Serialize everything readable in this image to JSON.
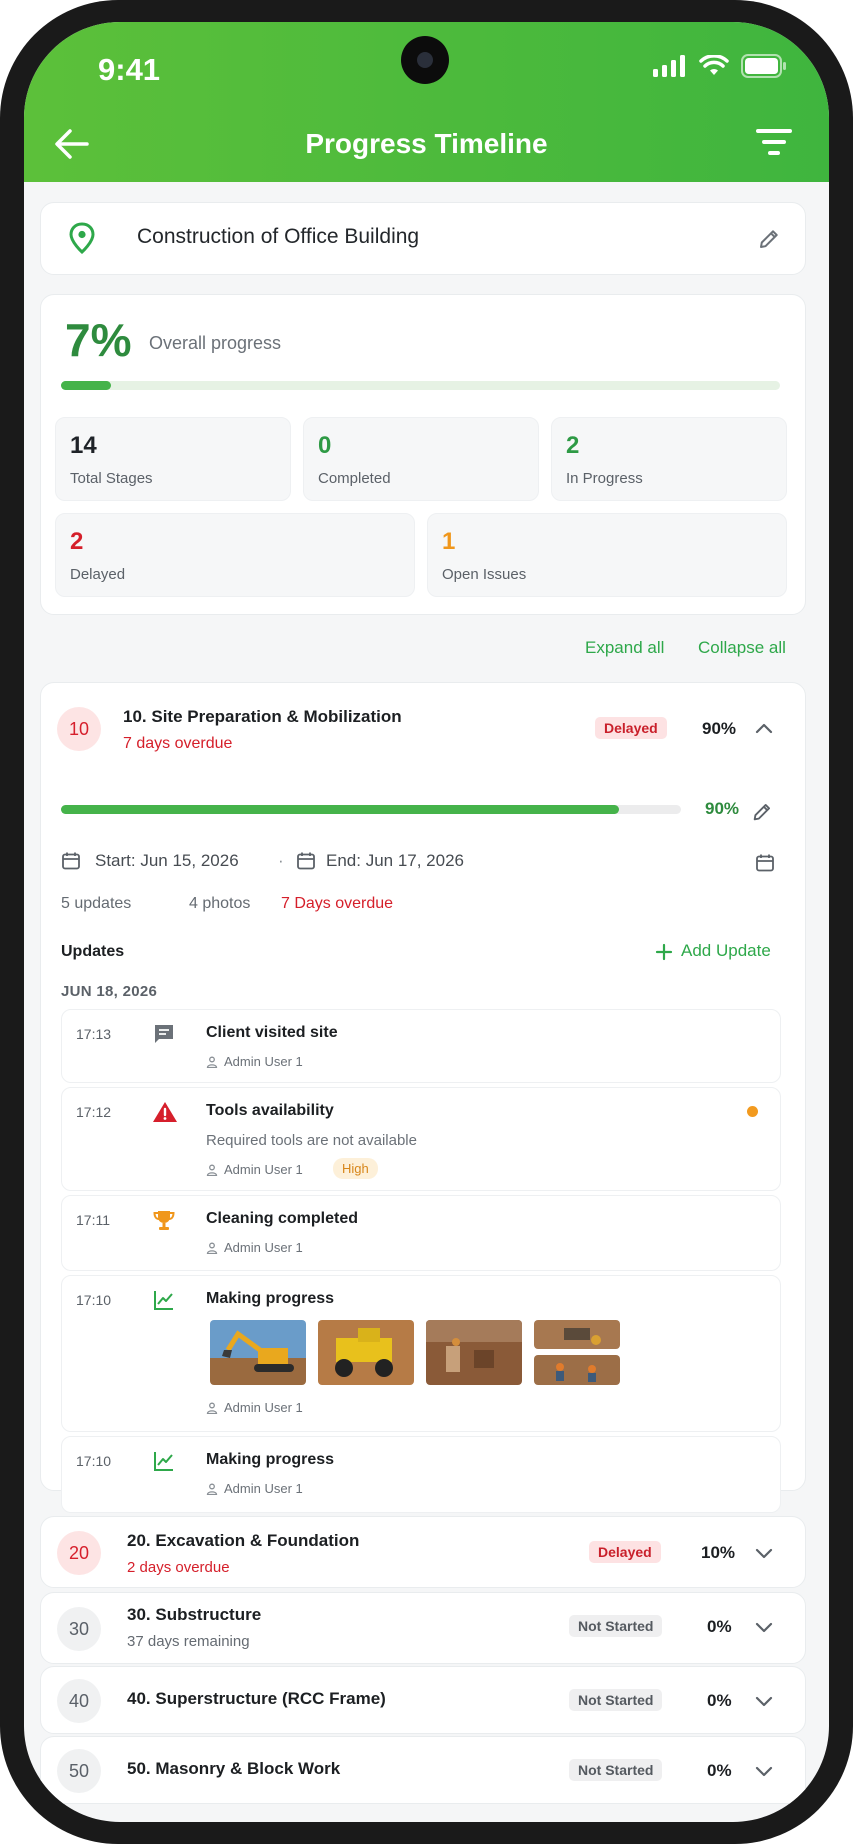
{
  "status_bar": {
    "time": "9:41"
  },
  "header": {
    "title": "Progress Timeline"
  },
  "project": {
    "name": "Construction of Office Building"
  },
  "overall": {
    "percent_label": "7%",
    "percent": 7,
    "label": "Overall progress",
    "stats": [
      {
        "value": "14",
        "label": "Total Stages",
        "color": "#2b2f33"
      },
      {
        "value": "0",
        "label": "Completed",
        "color": "#2e9a45"
      },
      {
        "value": "2",
        "label": "In Progress",
        "color": "#2e9a45"
      },
      {
        "value": "2",
        "label": "Delayed",
        "color": "#d51f2a"
      },
      {
        "value": "1",
        "label": "Open Issues",
        "color": "#f0971c"
      }
    ]
  },
  "actions": {
    "expand_all": "Expand all",
    "collapse_all": "Collapse all"
  },
  "expanded_stage": {
    "number": "10",
    "title": "10. Site Preparation & Mobilization",
    "subtitle": "7 days overdue",
    "status": "Delayed",
    "percent_label": "90%",
    "percent": 90,
    "start": "Start: Jun 15, 2026",
    "separator": "·",
    "end": "End: Jun 17, 2026",
    "updates_count": "5 updates",
    "photos_count": "4 photos",
    "overdue": "7 Days overdue",
    "updates_heading": "Updates",
    "add_update": "Add Update",
    "day": "JUN 18, 2026",
    "updates": [
      {
        "time": "17:13",
        "title": "Client visited site",
        "user": "Admin User 1",
        "icon": "comment-icon"
      },
      {
        "time": "17:12",
        "title": "Tools availability",
        "description": "Required tools are not available",
        "user": "Admin User 1",
        "priority": "High",
        "icon": "warning-icon"
      },
      {
        "time": "17:11",
        "title": "Cleaning completed",
        "user": "Admin User 1",
        "icon": "trophy-icon"
      },
      {
        "time": "17:10",
        "title": "Making progress",
        "user": "Admin User 1",
        "icon": "trend-icon"
      },
      {
        "time": "17:10",
        "title": "Making progress",
        "user": "Admin User 1",
        "icon": "trend-icon"
      }
    ]
  },
  "stages": [
    {
      "number": "20",
      "title": "20. Excavation & Foundation",
      "subtitle": "2 days overdue",
      "status": "Delayed",
      "percent_label": "10%"
    },
    {
      "number": "30",
      "title": "30. Substructure",
      "subtitle": "37 days remaining",
      "status": "Not Started",
      "percent_label": "0%"
    },
    {
      "number": "40",
      "title": "40. Superstructure (RCC Frame)",
      "status": "Not Started",
      "percent_label": "0%"
    },
    {
      "number": "50",
      "title": "50. Masonry & Block Work",
      "status": "Not Started",
      "percent_label": "0%"
    }
  ],
  "colors": {
    "brand_green": "#45b34a",
    "delayed_red": "#d51f2a",
    "warning_orange": "#f0971c"
  }
}
